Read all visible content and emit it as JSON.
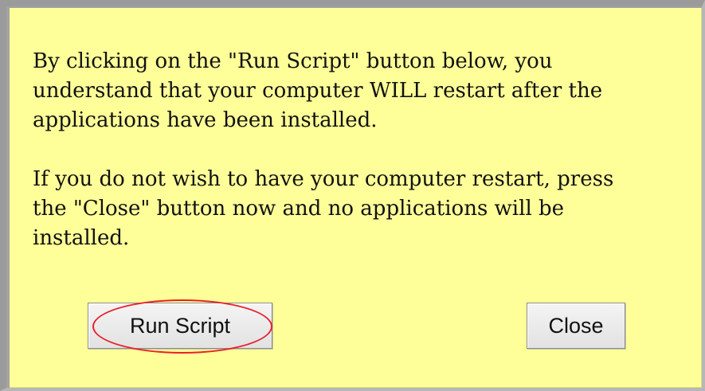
{
  "dialog": {
    "paragraphs": [
      "By clicking on the \"Run Script\" button below, you\nunderstand that your computer WILL restart after the\napplications have been installed.",
      "If you do not wish to have your computer restart, press\nthe \"Close\" button now and no applications will be\ninstalled."
    ],
    "background_color": "#ffff99",
    "buttons": {
      "run_script_label": "Run Script",
      "close_label": "Close"
    }
  },
  "annotation": {
    "highlight": "red ellipse around Run Script button",
    "color": "#e8202a"
  }
}
